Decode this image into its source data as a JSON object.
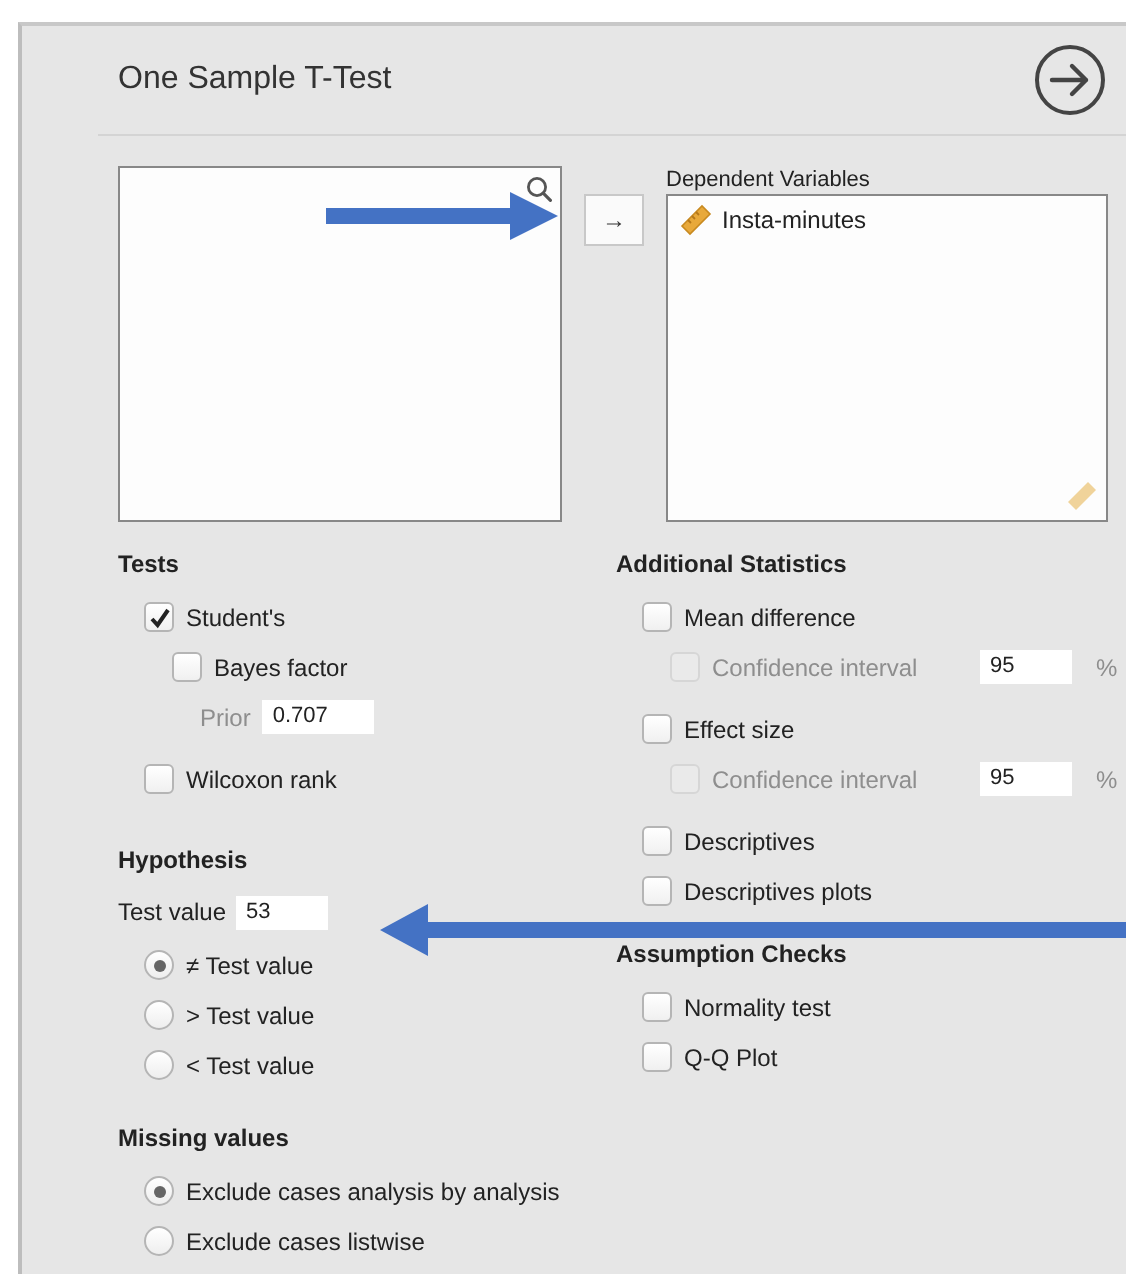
{
  "window": {
    "title": "One Sample T-Test"
  },
  "assign_button": {
    "label": "→"
  },
  "dependent_variables": {
    "label": "Dependent Variables",
    "items": [
      {
        "name": "Insta-minutes"
      }
    ]
  },
  "tests": {
    "title": "Tests",
    "items": [
      {
        "kind": "checkbox",
        "label": "Student's",
        "checked": true,
        "children": [
          {
            "kind": "checkbox",
            "label": "Bayes factor",
            "checked": false,
            "children": [
              {
                "kind": "field",
                "label": "Prior",
                "value": "0.707",
                "disabled": true
              }
            ]
          }
        ]
      },
      {
        "kind": "checkbox",
        "label": "Wilcoxon rank",
        "checked": false
      }
    ]
  },
  "hypothesis": {
    "title": "Hypothesis",
    "test_value": {
      "label": "Test value",
      "value": "53"
    },
    "options": [
      {
        "label": "≠ Test value",
        "selected": true
      },
      {
        "label": "> Test value",
        "selected": false
      },
      {
        "label": "< Test value",
        "selected": false
      }
    ]
  },
  "missing_values": {
    "title": "Missing values",
    "options": [
      {
        "label": "Exclude cases analysis by analysis",
        "selected": true
      },
      {
        "label": "Exclude cases listwise",
        "selected": false
      }
    ]
  },
  "additional_statistics": {
    "title": "Additional Statistics",
    "items": [
      {
        "kind": "checkbox",
        "label": "Mean difference",
        "checked": false,
        "children": [
          {
            "kind": "interval",
            "label": "Confidence interval",
            "checked": false,
            "disabled": true,
            "value": "95",
            "unit": "%"
          }
        ]
      },
      {
        "kind": "checkbox",
        "label": "Effect size",
        "checked": false,
        "children": [
          {
            "kind": "interval",
            "label": "Confidence interval",
            "checked": false,
            "disabled": true,
            "value": "95",
            "unit": "%"
          }
        ]
      },
      {
        "kind": "checkbox",
        "label": "Descriptives",
        "checked": false
      },
      {
        "kind": "checkbox",
        "label": "Descriptives plots",
        "checked": false
      }
    ]
  },
  "assumption_checks": {
    "title": "Assumption Checks",
    "items": [
      {
        "kind": "checkbox",
        "label": "Normality test",
        "checked": false
      },
      {
        "kind": "checkbox",
        "label": "Q-Q Plot",
        "checked": false
      }
    ]
  }
}
